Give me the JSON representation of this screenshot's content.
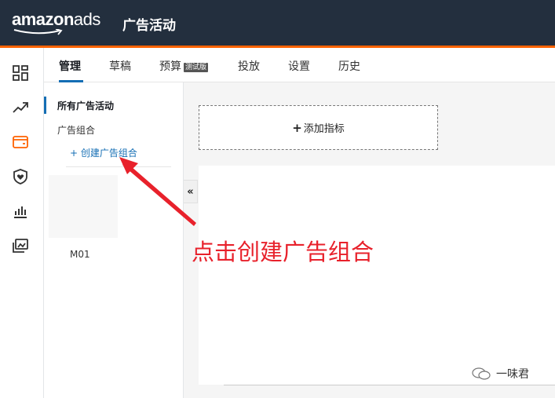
{
  "brand": {
    "logo_bold": "amazon",
    "logo_light": "ads",
    "accent": "#ff6200",
    "header_bg": "#232f3e"
  },
  "header": {
    "title": "广告活动"
  },
  "rail": {
    "icons": [
      "dashboard-icon",
      "trending-icon",
      "campaign-icon",
      "shield-heart-icon",
      "bar-chart-icon",
      "media-library-icon"
    ]
  },
  "tabs": [
    {
      "label": "管理",
      "active": true
    },
    {
      "label": "草稿"
    },
    {
      "label": "预算",
      "badge": "测试版"
    },
    {
      "label": "投放"
    },
    {
      "label": "设置"
    },
    {
      "label": "历史"
    }
  ],
  "panel": {
    "all_campaigns": "所有广告活动",
    "ad_groups": "广告组合",
    "create_group": "+ 创建广告组合",
    "thumb_label": "M01"
  },
  "collapse": {
    "glyph": "«"
  },
  "main": {
    "add_metric": "添加指标",
    "add_metric_plus": "+"
  },
  "annotation": {
    "text": "点击创建广告组合",
    "color": "#e8212b"
  },
  "watermark": {
    "text": "一味君"
  }
}
